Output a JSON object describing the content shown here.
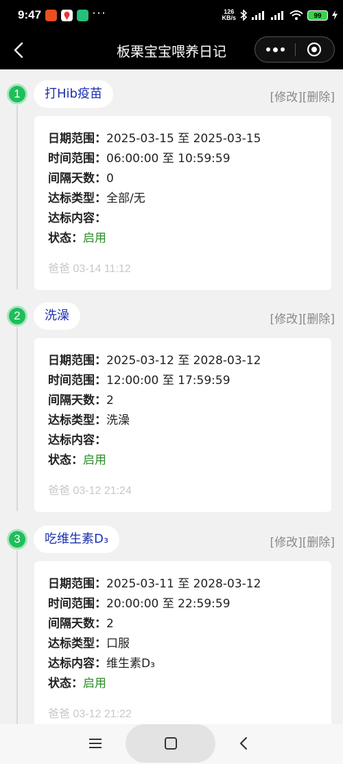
{
  "status_bar": {
    "time": "9:47",
    "app_icons": [
      "red-app-icon",
      "map-pin-app-icon",
      "green-app-icon"
    ],
    "more": "···",
    "net_speed_value": "126",
    "net_speed_unit": "KB/s",
    "battery": "99"
  },
  "nav": {
    "back_icon": "chevron-left-icon",
    "title": "板栗宝宝喂养日记"
  },
  "labels": {
    "date_range": "日期范围：",
    "time_range": "时间范围：",
    "interval": "间隔天数：",
    "target_type": "达标类型：",
    "target_content": "达标内容：",
    "status": "状态：",
    "edit": "[修改]",
    "delete": "[删除]"
  },
  "entries": [
    {
      "index": "1",
      "name": "打Hib疫苗",
      "date_range": "2025-03-15 至 2025-03-15",
      "time_range": "06:00:00 至 10:59:59",
      "interval": "0",
      "target_type": "全部/无",
      "target_content": "",
      "status": "启用",
      "created": "爸爸 03-14 11:12"
    },
    {
      "index": "2",
      "name": "洗澡",
      "date_range": "2025-03-12 至 2028-03-12",
      "time_range": "12:00:00 至 17:59:59",
      "interval": "2",
      "target_type": "洗澡",
      "target_content": "",
      "status": "启用",
      "created": "爸爸 03-12 21:24"
    },
    {
      "index": "3",
      "name": "吃维生素D₃",
      "date_range": "2025-03-11 至 2028-03-12",
      "time_range": "20:00:00 至 22:59:59",
      "interval": "2",
      "target_type": "口服",
      "target_content": "维生素D₃",
      "status": "启用",
      "created": "爸爸 03-12 21:22"
    }
  ],
  "colors": {
    "accent_green": "#1fbe5b",
    "name_blue": "#1b2fae",
    "status_green": "#2a8f2a"
  }
}
